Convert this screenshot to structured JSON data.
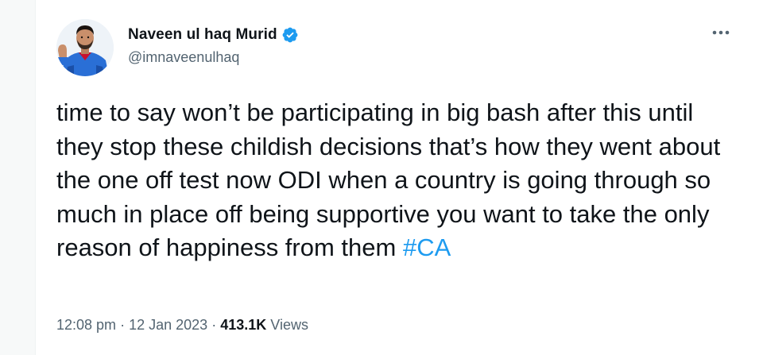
{
  "author": {
    "display_name": "Naveen ul haq Murid",
    "handle": "@imnaveenulhaq",
    "verified": true,
    "verified_icon": "verified-badge-icon",
    "avatar_icon": "profile-photo"
  },
  "menu": {
    "icon": "more-options-icon"
  },
  "tweet": {
    "text": "time to say won’t be participating in big bash after this until they stop these childish decisions that’s how they went about the one off test now ODI when a country is going through so much in place off being supportive you want to take the only reason of happiness from them",
    "hashtag": "#CA"
  },
  "meta": {
    "time": "12:08 pm",
    "separator": "·",
    "date": "12 Jan 2023",
    "views_count": "413.1K",
    "views_label": "Views"
  },
  "colors": {
    "link": "#1d9bf0",
    "text_primary": "#0f1419",
    "text_secondary": "#536471",
    "verified": "#1d9bf0"
  }
}
